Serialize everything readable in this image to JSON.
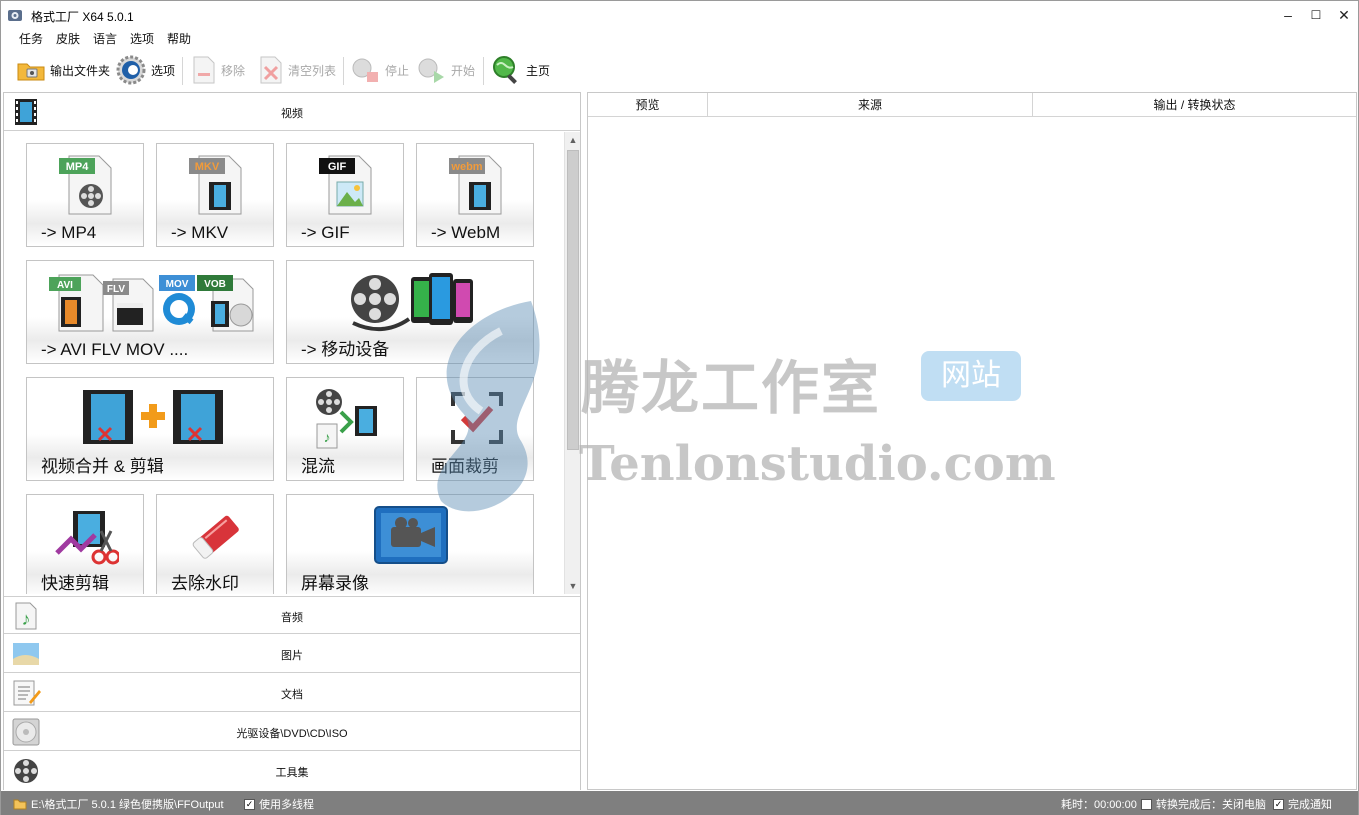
{
  "titlebar": {
    "title": "格式工厂 X64 5.0.1",
    "minimize": "–",
    "maximize": "☐",
    "close": "✕"
  },
  "menu": [
    "任务",
    "皮肤",
    "语言",
    "选项",
    "帮助"
  ],
  "toolbar": {
    "output_folder": "输出文件夹",
    "options": "选项",
    "remove": "移除",
    "clear_list": "清空列表",
    "stop": "停止",
    "start": "开始",
    "home": "主页"
  },
  "categories": {
    "video": "视频",
    "audio": "音频",
    "image": "图片",
    "document": "文档",
    "disc": "光驱设备\\DVD\\CD\\ISO",
    "tools": "工具集"
  },
  "video_tiles": {
    "mp4": "-> MP4",
    "mkv": "-> MKV",
    "gif": "-> GIF",
    "webm": "-> WebM",
    "avi_flv_mov": "-> AVI FLV MOV ....",
    "mobile": "-> 移动设备",
    "merge": "视频合并 & 剪辑",
    "mux": "混流",
    "crop": "画面裁剪",
    "quick_cut": "快速剪辑",
    "remove_watermark": "去除水印",
    "screen_record": "屏幕录像"
  },
  "tile_badges": {
    "mp4": "MP4",
    "mkv": "MKV",
    "gif": "GIF",
    "webm": "webm",
    "avi": "AVI",
    "flv": "FLV",
    "mov": "MOV",
    "vob": "VOB"
  },
  "table": {
    "col_preview": "预览",
    "col_source": "来源",
    "col_status": "输出 / 转换状态"
  },
  "watermark": {
    "cn": "腾龙工作室",
    "badge": "网站",
    "en": "Tenlonstudio.com"
  },
  "status": {
    "output_path": "E:\\格式工厂 5.0.1 绿色便携版\\FFOutput",
    "multithread": "使用多线程",
    "elapsed": "耗时：00:00:00",
    "shutdown": "转换完成后：关闭电脑",
    "notify": "完成通知"
  },
  "colors": {
    "statusbar": "#7f7f7f",
    "accent_red": "#d33a3a",
    "accent_green": "#3aa04a"
  }
}
